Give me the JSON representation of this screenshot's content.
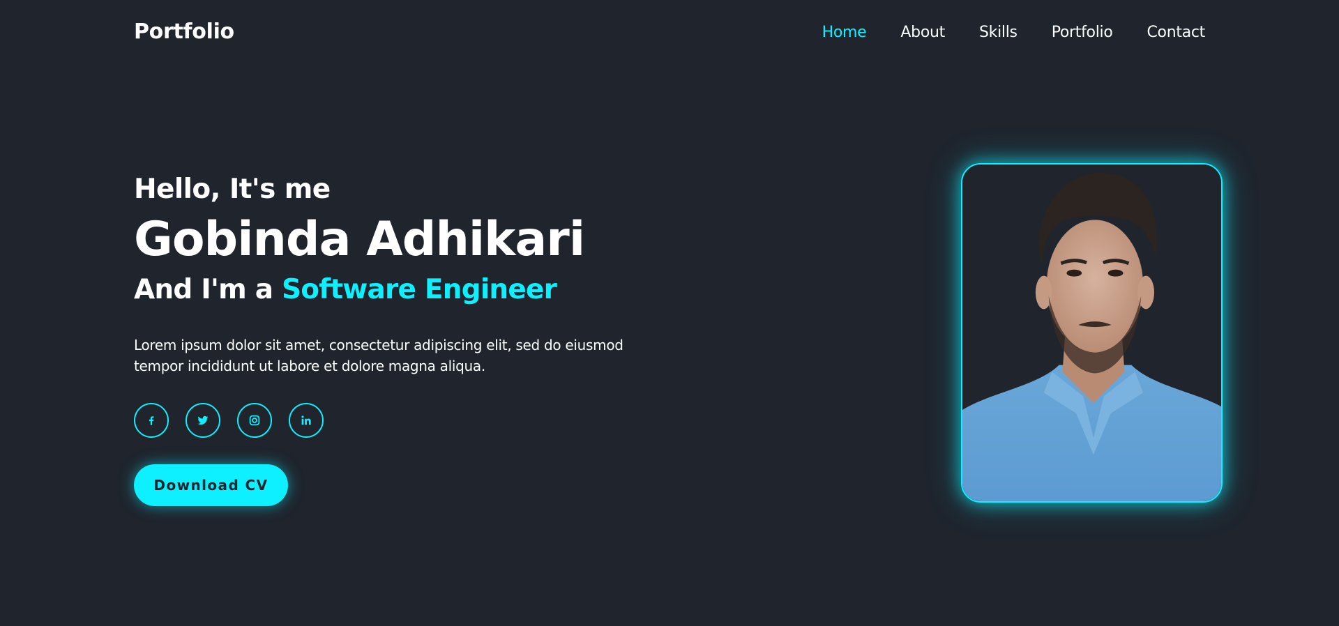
{
  "header": {
    "logo": "Portfolio",
    "nav": [
      {
        "label": "Home",
        "active": true
      },
      {
        "label": "About",
        "active": false
      },
      {
        "label": "Skills",
        "active": false
      },
      {
        "label": "Portfolio",
        "active": false
      },
      {
        "label": "Contact",
        "active": false
      }
    ]
  },
  "hero": {
    "greeting": "Hello, It's me",
    "name": "Gobinda Adhikari",
    "role_prefix": "And I'm a ",
    "role_highlight": "Software Engineer",
    "description": "Lorem ipsum dolor sit amet, consectetur adipiscing elit, sed do eiusmod tempor incididunt ut labore et dolore magna aliqua.",
    "socials": [
      {
        "icon": "facebook-icon"
      },
      {
        "icon": "twitter-icon"
      },
      {
        "icon": "instagram-icon"
      },
      {
        "icon": "linkedin-icon"
      }
    ],
    "button_label": "Download CV"
  },
  "colors": {
    "background": "#1f242d",
    "accent": "#0ef0ff",
    "text": "#ffffff"
  }
}
